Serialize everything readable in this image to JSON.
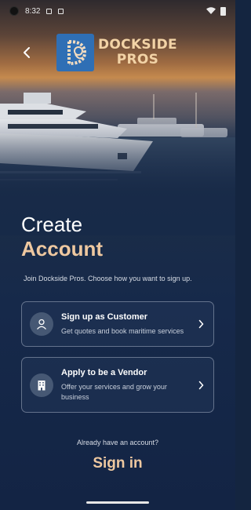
{
  "status_bar": {
    "time": "8:32"
  },
  "header": {
    "logo_line1": "DOCKSIDE",
    "logo_line2": "PROS"
  },
  "title": {
    "line1": "Create",
    "line2": "Account"
  },
  "subtitle": "Join Dockside Pros. Choose how you want to sign up.",
  "options": [
    {
      "title": "Sign up as Customer",
      "description": "Get quotes and book maritime services",
      "icon": "person-icon"
    },
    {
      "title": "Apply to be a Vendor",
      "description": "Offer your services and grow your business",
      "icon": "building-icon"
    }
  ],
  "footer": {
    "prompt": "Already have an account?",
    "signin_label": "Sign in"
  },
  "colors": {
    "accent": "#eec8a0",
    "background": "#142540",
    "logo_blue": "#2f6fb5"
  }
}
